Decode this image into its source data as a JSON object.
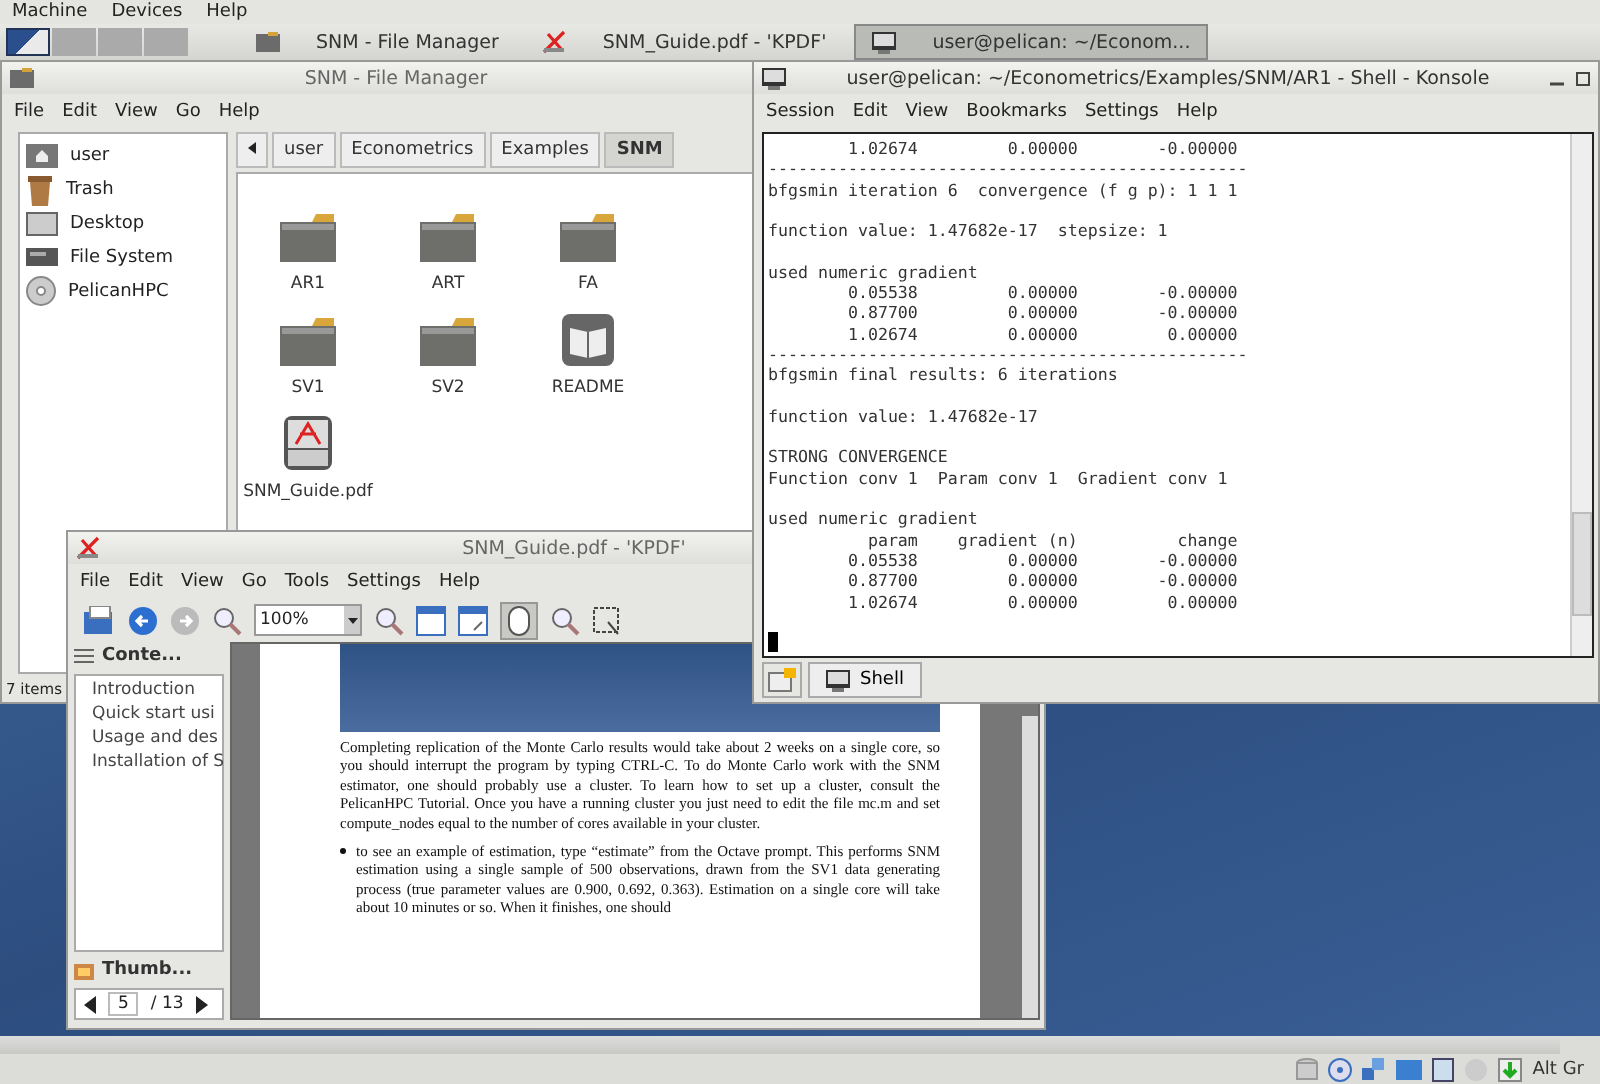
{
  "host_menu": [
    "Machine",
    "Devices",
    "Help"
  ],
  "taskbar": {
    "pager": [
      {
        "selected": true
      },
      {
        "selected": false
      },
      {
        "selected": false
      },
      {
        "selected": false
      }
    ],
    "tasks": [
      {
        "label": "SNM - File Manager",
        "kind": "folder",
        "selected": false
      },
      {
        "label": "SNM_Guide.pdf - 'KPDF'",
        "kind": "pdf",
        "selected": false
      },
      {
        "label": "user@pelican: ~/Econom...",
        "kind": "terminal",
        "selected": true
      }
    ]
  },
  "file_manager": {
    "title": "SNM - File Manager",
    "menu": [
      "File",
      "Edit",
      "View",
      "Go",
      "Help"
    ],
    "places": [
      {
        "label": "user",
        "kind": "home"
      },
      {
        "label": "Trash",
        "kind": "trash"
      },
      {
        "label": "Desktop",
        "kind": "desktop"
      },
      {
        "label": "File System",
        "kind": "drive"
      },
      {
        "label": "PelicanHPC",
        "kind": "disc"
      }
    ],
    "breadcrumb": [
      {
        "label": "user",
        "selected": false
      },
      {
        "label": "Econometrics",
        "selected": false
      },
      {
        "label": "Examples",
        "selected": false
      },
      {
        "label": "SNM",
        "selected": true
      }
    ],
    "items": [
      {
        "label": "AR1",
        "kind": "folder"
      },
      {
        "label": "ART",
        "kind": "folder"
      },
      {
        "label": "FA",
        "kind": "folder"
      },
      {
        "label": "SV1",
        "kind": "folder"
      },
      {
        "label": "SV2",
        "kind": "folder"
      },
      {
        "label": "README",
        "kind": "book"
      },
      {
        "label": "SNM_Guide.pdf",
        "kind": "pdf"
      }
    ],
    "status": "7 items"
  },
  "konsole": {
    "title": "user@pelican: ~/Econometrics/Examples/SNM/AR1 - Shell - Konsole",
    "menu": [
      "Session",
      "Edit",
      "View",
      "Bookmarks",
      "Settings",
      "Help"
    ],
    "blocks": [
      [
        "        1.02674         0.00000        -0.00000",
        "------------------------------------------------",
        "bfgsmin iteration 6  convergence (f g p): 1 1 1"
      ],
      [
        "function value: 1.47682e-17  stepsize: 1"
      ],
      [
        "used numeric gradient",
        "        0.05538         0.00000        -0.00000",
        "        0.87700         0.00000        -0.00000",
        "        1.02674         0.00000         0.00000",
        "------------------------------------------------",
        "bfgsmin final results: 6 iterations"
      ],
      [
        "function value: 1.47682e-17"
      ],
      [
        "STRONG CONVERGENCE",
        "Function conv 1  Param conv 1  Gradient conv 1"
      ],
      [
        "used numeric gradient",
        "          param    gradient (n)          change",
        "        0.05538         0.00000        -0.00000",
        "        0.87700         0.00000        -0.00000",
        "        1.02674         0.00000         0.00000"
      ]
    ],
    "tabs": [
      "Shell"
    ]
  },
  "kpdf": {
    "title": "SNM_Guide.pdf - 'KPDF'",
    "menu": [
      "File",
      "Edit",
      "View",
      "Go",
      "Tools",
      "Settings",
      "Help"
    ],
    "zoom": "100%",
    "contents_tab": "Conte...",
    "toc": [
      "Introduction",
      "Quick start usi",
      "Usage and des",
      "Installation of S"
    ],
    "thumbnails_tab": "Thumb...",
    "page": "5",
    "page_count": "/ 13",
    "paragraph": "Completing replication of the Monte Carlo results would take about 2 weeks on a single core, so you should interrupt the program by typing CTRL-C. To do Monte Carlo work with the SNM estimator, one should probably use a cluster. To learn how to set up a cluster, consult the PelicanHPC Tutorial. Once you have a running cluster you just need to edit the file mc.m and set compute_nodes equal to the number of cores available in your cluster.",
    "bullets": [
      "to see an example of estimation, type “estimate” from the Octave prompt. This performs SNM estimation using a single sample of 500 observations, drawn from the SV1 data generating process (true parameter values are 0.900, 0.692, 0.363). Estimation on a single core will take about 10 minutes or so. When it finishes, one should"
    ]
  },
  "status_bar": {
    "keyboard": "Alt Gr"
  }
}
